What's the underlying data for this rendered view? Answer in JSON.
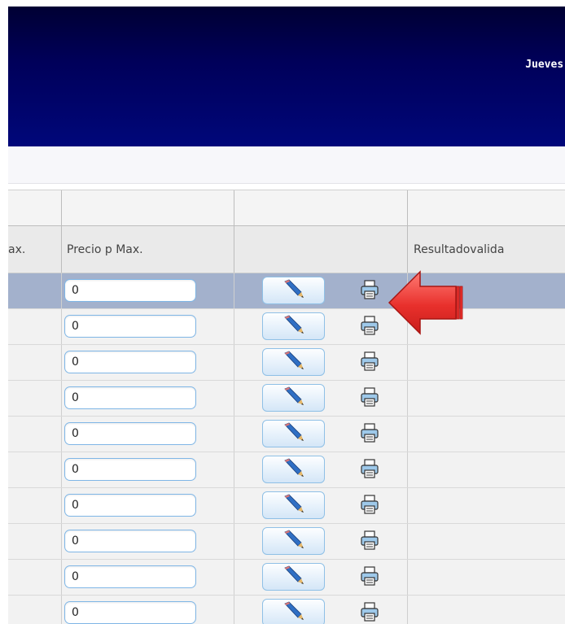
{
  "header": {
    "date_text": "Jueves,"
  },
  "table": {
    "columns": {
      "col_prev_partial": "ax.",
      "precio_max": "Precio p Max.",
      "actions": "",
      "resultado": "Resultadovalida"
    },
    "rows": [
      {
        "precio": "0",
        "selected": true
      },
      {
        "precio": "0",
        "selected": false
      },
      {
        "precio": "0",
        "selected": false
      },
      {
        "precio": "0",
        "selected": false
      },
      {
        "precio": "0",
        "selected": false
      },
      {
        "precio": "0",
        "selected": false
      },
      {
        "precio": "0",
        "selected": false
      },
      {
        "precio": "0",
        "selected": false
      },
      {
        "precio": "0",
        "selected": false
      },
      {
        "precio": "0",
        "selected": false
      }
    ],
    "edit_icon": "pencil-icon",
    "print_icon": "printer-icon"
  },
  "annotation": {
    "arrow_color": "#e8302c",
    "arrow_icon": "red-arrow-left"
  },
  "colors": {
    "header_bg": "#00005a",
    "selected_row": "#a3b1cc",
    "input_border": "#7fb6e6"
  }
}
